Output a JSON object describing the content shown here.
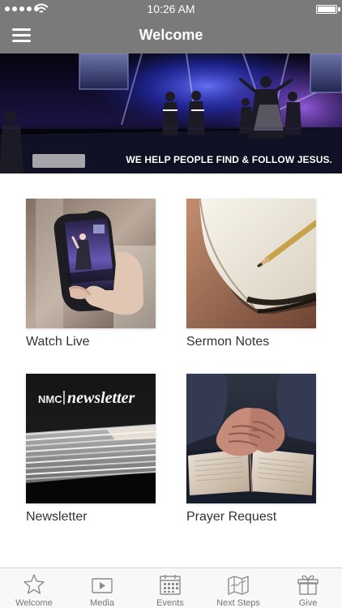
{
  "status_bar": {
    "time": "10:26 AM"
  },
  "nav": {
    "title": "Welcome",
    "menu_icon": "hamburger-menu-icon"
  },
  "banner": {
    "tagline": "WE HELP PEOPLE FIND & FOLLOW JESUS."
  },
  "tiles": [
    {
      "label": "Watch Live",
      "image": "phone-livestream-image"
    },
    {
      "label": "Sermon Notes",
      "image": "notebook-pencil-image"
    },
    {
      "label": "Newsletter",
      "image": "newsletter-stack-image",
      "image_text": {
        "logo": "NMC",
        "title": "newsletter"
      }
    },
    {
      "label": "Prayer Request",
      "image": "praying-hands-image"
    }
  ],
  "tab_bar": {
    "items": [
      {
        "label": "Welcome",
        "icon": "star-icon",
        "active": true
      },
      {
        "label": "Media",
        "icon": "video-icon",
        "active": false
      },
      {
        "label": "Events",
        "icon": "calendar-icon",
        "active": false
      },
      {
        "label": "Next Steps",
        "icon": "map-icon",
        "active": false
      },
      {
        "label": "Give",
        "icon": "gift-icon",
        "active": false
      }
    ]
  },
  "colors": {
    "header_gray": "#7a7a7a",
    "tab_bar_background": "#f8f8f8",
    "tab_icon_gray": "#8c8c8c",
    "label_text": "#333333"
  }
}
